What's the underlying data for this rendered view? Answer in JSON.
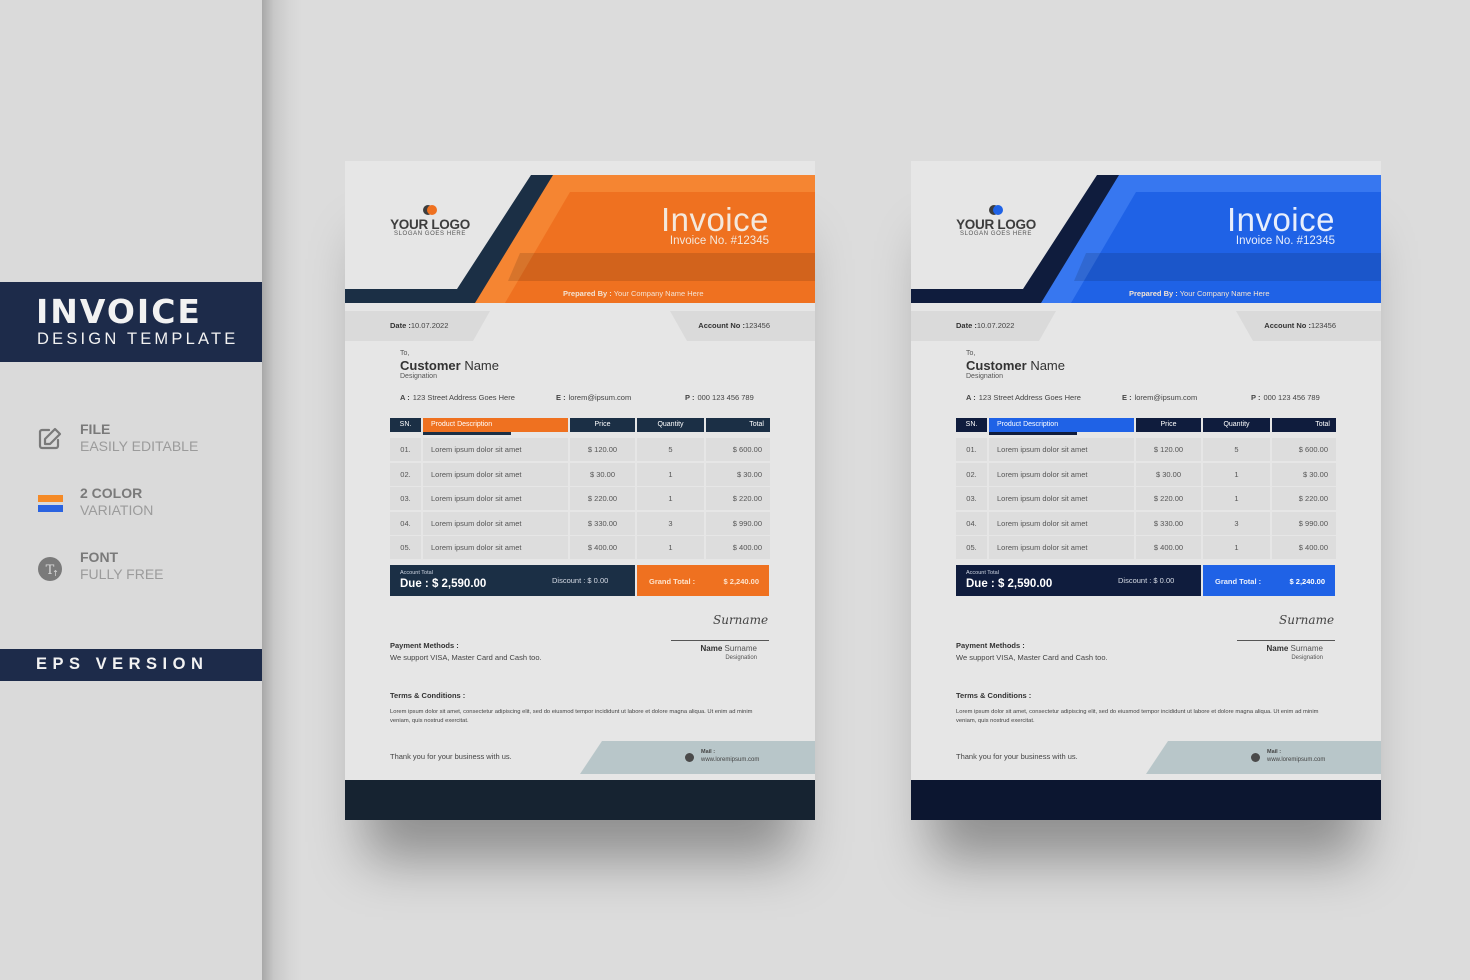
{
  "sidebar": {
    "title": "INVOICE",
    "subtitle": "DESIGN TEMPLATE",
    "features": [
      {
        "icon": "edit-icon",
        "title": "FILE",
        "subtitle": "EASILY EDITABLE"
      },
      {
        "icon": "color-swatch-icon",
        "title": "2 COLOR",
        "subtitle": "VARIATION",
        "colors": [
          "#f58a26",
          "#2a63e0"
        ]
      },
      {
        "icon": "font-icon",
        "title": "FONT",
        "subtitle": "FULLY FREE"
      }
    ],
    "badge": "EPS VERSION"
  },
  "invoices": [
    {
      "variant": "orange",
      "accent": "#ef7120",
      "accent_light": "#f58532",
      "dark": "#1b2f45",
      "footer": "#162331",
      "logo": {
        "text": "YOUR LOGO",
        "slogan": "SLOGAN GOES HERE"
      },
      "title": "Invoice",
      "invoice_no": "Invoice No. #12345",
      "prepared_by_label": "Prepared By :",
      "prepared_by_value": "Your Company Name Here",
      "date_label": "Date :",
      "date_value": "10.07.2022",
      "account_label": "Account No :",
      "account_value": "123456",
      "to": "To,",
      "customer_bold": "Customer",
      "customer_rest": "Name",
      "designation": "Designation",
      "address_label": "A :",
      "address": "123 Street Address Goes Here",
      "email_label": "E :",
      "email": "lorem@ipsum.com",
      "phone_label": "P :",
      "phone": "000 123 456 789",
      "table": {
        "headers": [
          "SN.",
          "Product Description",
          "Price",
          "Quantity",
          "Total"
        ],
        "rows": [
          [
            "01.",
            "Lorem ipsum dolor sit amet",
            "$ 120.00",
            "5",
            "$ 600.00"
          ],
          [
            "02.",
            "Lorem ipsum dolor sit amet",
            "$ 30.00",
            "1",
            "$ 30.00"
          ],
          [
            "03.",
            "Lorem ipsum dolor sit amet",
            "$ 220.00",
            "1",
            "$ 220.00"
          ],
          [
            "04.",
            "Lorem ipsum dolor sit amet",
            "$ 330.00",
            "3",
            "$ 990.00"
          ],
          [
            "05.",
            "Lorem ipsum dolor sit amet",
            "$ 400.00",
            "1",
            "$ 400.00"
          ]
        ]
      },
      "account_total_label": "Account Total",
      "due": "Due : $ 2,590.00",
      "discount": "Discount : $ 0.00",
      "grand_total_label": "Grand Total :",
      "grand_total_value": "$ 2,240.00",
      "signature": "Surname",
      "sig_name_bold": "Name",
      "sig_name_rest": "Surname",
      "sig_designation": "Designation",
      "payment_title": "Payment Methods :",
      "payment_text": "We support VISA, Master Card and Cash too.",
      "terms_title": "Terms & Conditions :",
      "terms_text": "Lorem ipsum dolor sit amet, consectetur adipiscing elit, sed do eiusmod tempor incididunt ut labore et dolore magna aliqua. Ut enim ad minim veniam, quis nostrud exercitat.",
      "thanks": "Thank you for your business with us.",
      "mail_label": "Mail :",
      "mail_value": "www.loremipsum.com"
    },
    {
      "variant": "blue",
      "accent": "#1f62e6",
      "accent_light": "#3777f0",
      "dark": "#0f1c3d",
      "footer": "#0c1630",
      "logo": {
        "text": "YOUR LOGO",
        "slogan": "SLOGAN GOES HERE"
      },
      "title": "Invoice",
      "invoice_no": "Invoice No. #12345",
      "prepared_by_label": "Prepared By :",
      "prepared_by_value": "Your Company Name Here",
      "date_label": "Date :",
      "date_value": "10.07.2022",
      "account_label": "Account No :",
      "account_value": "123456",
      "to": "To,",
      "customer_bold": "Customer",
      "customer_rest": "Name",
      "designation": "Designation",
      "address_label": "A :",
      "address": "123 Street Address Goes Here",
      "email_label": "E :",
      "email": "lorem@ipsum.com",
      "phone_label": "P :",
      "phone": "000 123 456 789",
      "table": {
        "headers": [
          "SN.",
          "Product Description",
          "Price",
          "Quantity",
          "Total"
        ],
        "rows": [
          [
            "01.",
            "Lorem ipsum dolor sit amet",
            "$ 120.00",
            "5",
            "$ 600.00"
          ],
          [
            "02.",
            "Lorem ipsum dolor sit amet",
            "$ 30.00",
            "1",
            "$ 30.00"
          ],
          [
            "03.",
            "Lorem ipsum dolor sit amet",
            "$ 220.00",
            "1",
            "$ 220.00"
          ],
          [
            "04.",
            "Lorem ipsum dolor sit amet",
            "$ 330.00",
            "3",
            "$ 990.00"
          ],
          [
            "05.",
            "Lorem ipsum dolor sit amet",
            "$ 400.00",
            "1",
            "$ 400.00"
          ]
        ]
      },
      "account_total_label": "Account Total",
      "due": "Due : $ 2,590.00",
      "discount": "Discount : $ 0.00",
      "grand_total_label": "Grand Total :",
      "grand_total_value": "$ 2,240.00",
      "signature": "Surname",
      "sig_name_bold": "Name",
      "sig_name_rest": "Surname",
      "sig_designation": "Designation",
      "payment_title": "Payment Methods :",
      "payment_text": "We support VISA, Master Card and Cash too.",
      "terms_title": "Terms & Conditions :",
      "terms_text": "Lorem ipsum dolor sit amet, consectetur adipiscing elit, sed do eiusmod tempor incididunt ut labore et dolore magna aliqua. Ut enim ad minim veniam, quis nostrud exercitat.",
      "thanks": "Thank you for your business with us.",
      "mail_label": "Mail :",
      "mail_value": "www.loremipsum.com"
    }
  ]
}
